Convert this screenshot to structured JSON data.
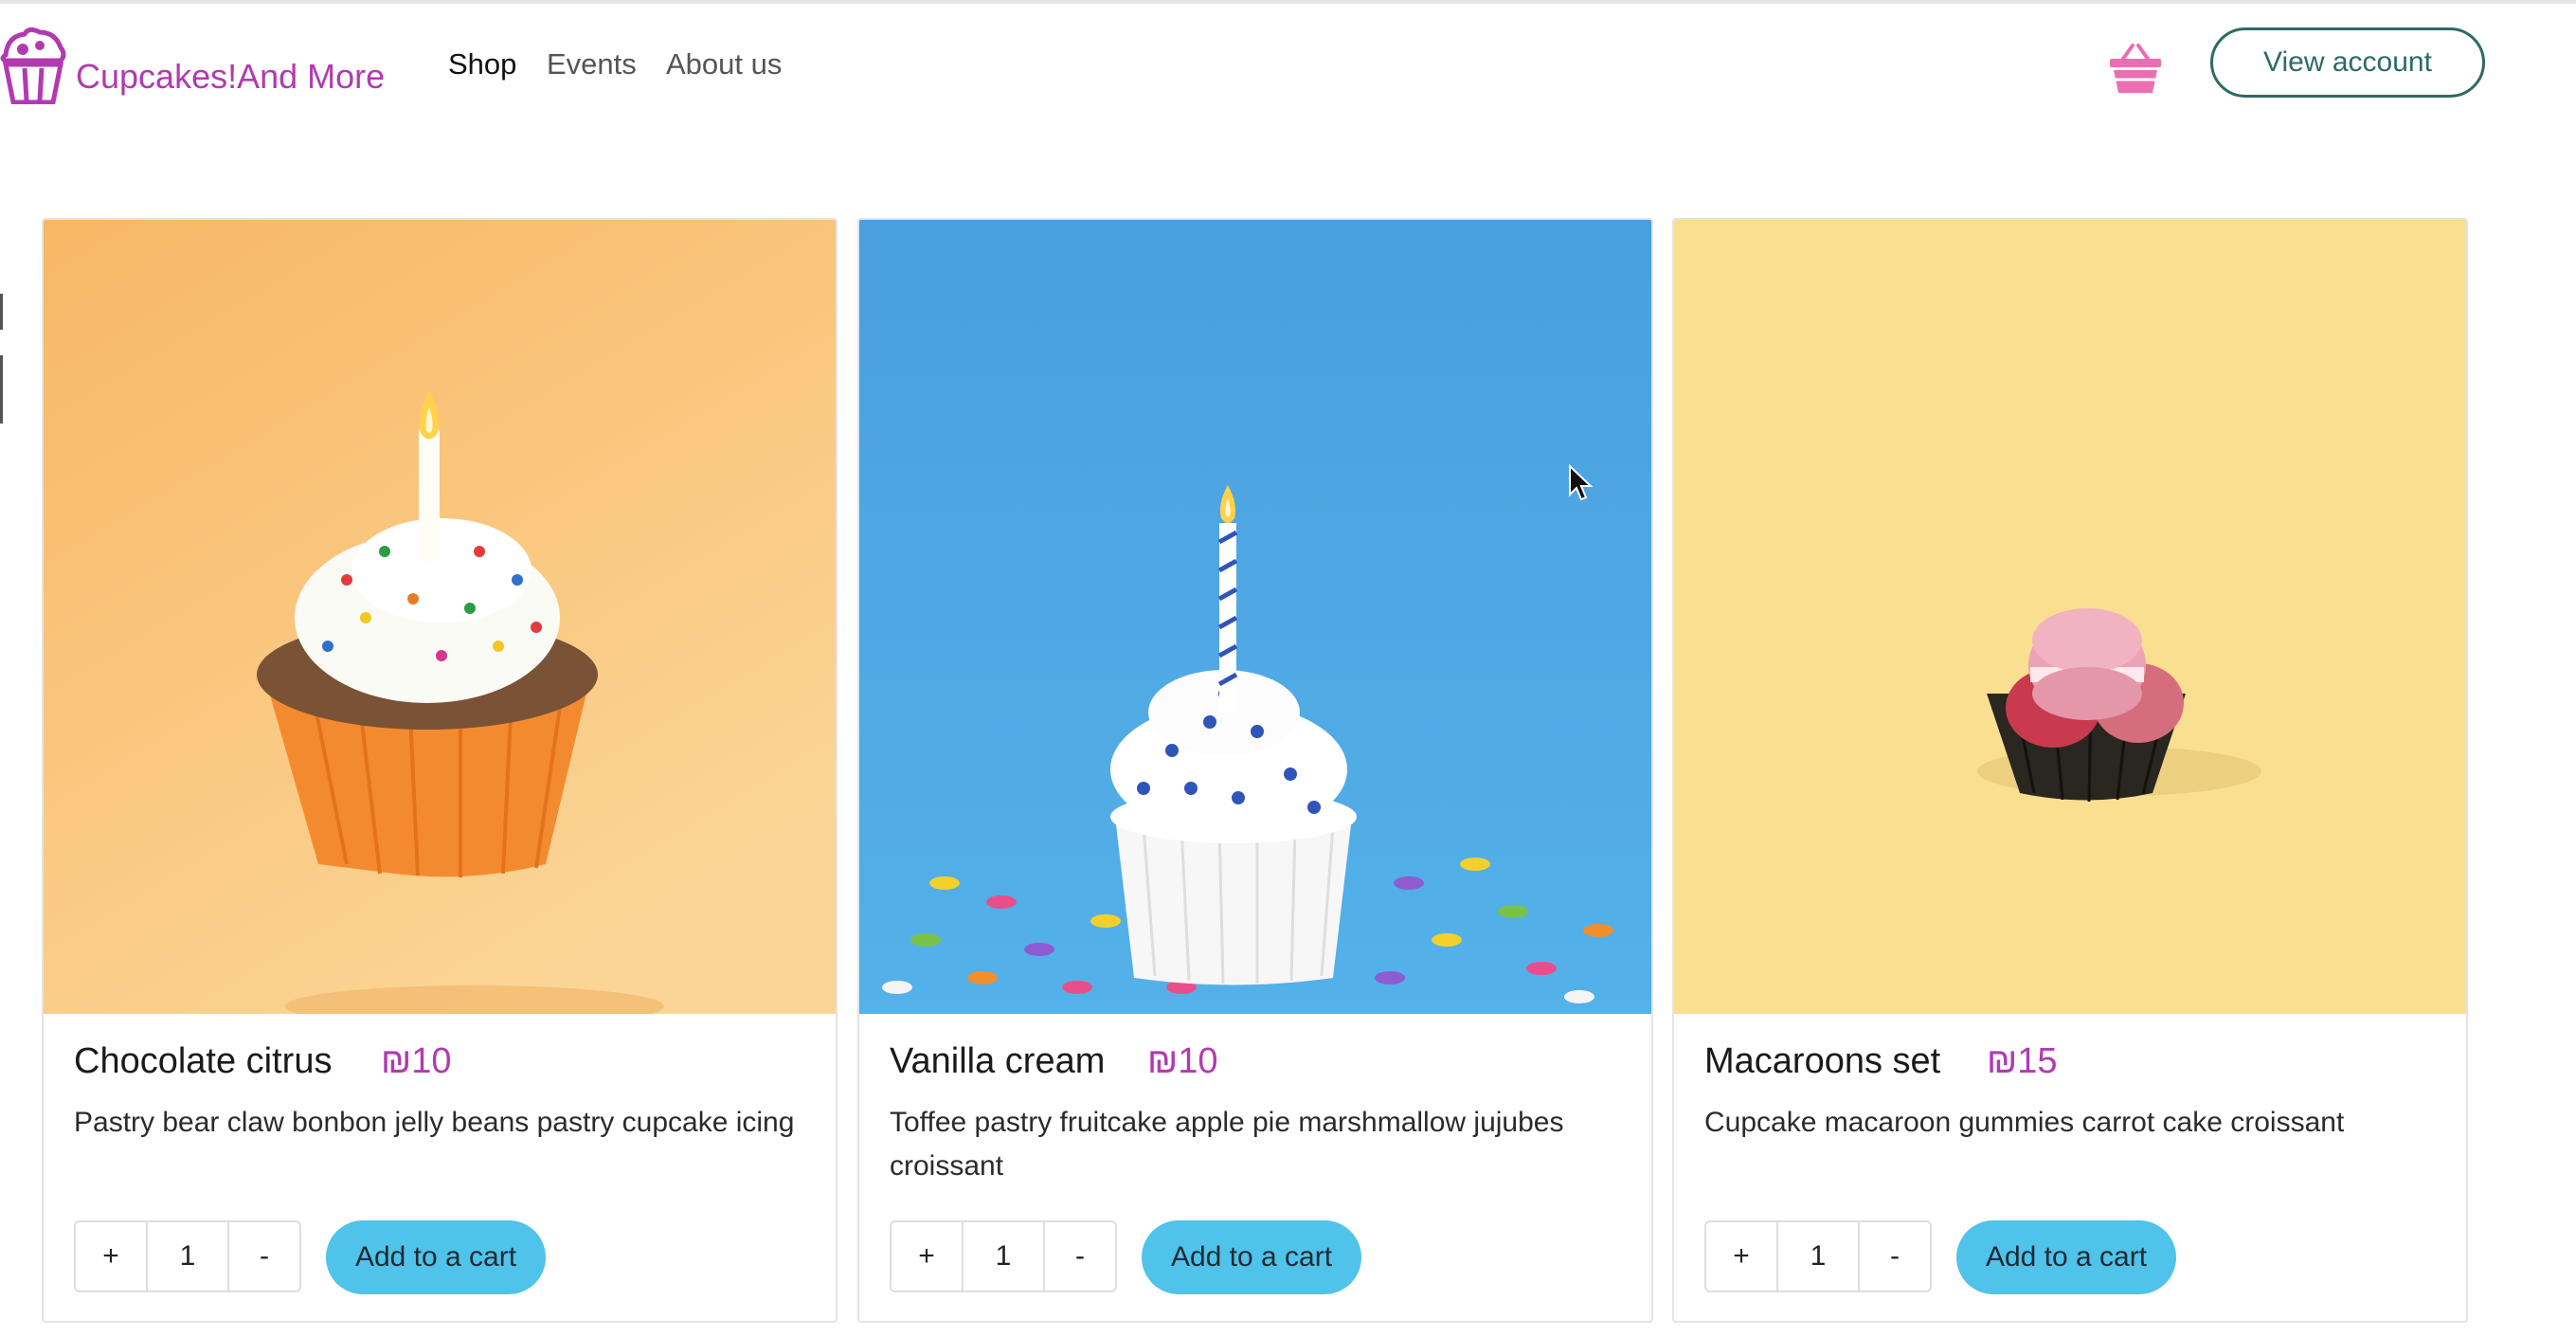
{
  "header": {
    "brand": "Cupcakes!And More",
    "nav": [
      {
        "label": "Shop",
        "active": true
      },
      {
        "label": "Events",
        "active": false
      },
      {
        "label": "About us",
        "active": false
      }
    ],
    "cart_icon": "basket-icon",
    "account_button": "View account"
  },
  "colors": {
    "brand": "#b23ab0",
    "accent_button": "#4fc3ea",
    "account_border": "#2d6b63",
    "card1_bg": "#f8b765",
    "card2_bg": "#4aa6e2",
    "card3_bg": "#f9df8f"
  },
  "products": [
    {
      "name": "Chocolate citrus",
      "price": "₪10",
      "description": "Pastry bear claw bonbon jelly beans pastry cupcake icing",
      "quantity": "1",
      "plus_label": "+",
      "minus_label": "-",
      "add_label": "Add to a cart",
      "image": "cupcake-with-candle-on-orange-background"
    },
    {
      "name": "Vanilla cream",
      "price": "₪10",
      "description": "Toffee pastry fruitcake apple pie marshmallow jujubes croissant",
      "quantity": "1",
      "plus_label": "+",
      "minus_label": "-",
      "add_label": "Add to a cart",
      "image": "vanilla-cupcake-with-candle-on-blue-background"
    },
    {
      "name": "Macaroons set",
      "price": "₪15",
      "description": "Cupcake macaroon gummies carrot cake croissant",
      "quantity": "1",
      "plus_label": "+",
      "minus_label": "-",
      "add_label": "Add to a cart",
      "image": "macarons-in-paper-cup-on-yellow-background"
    }
  ]
}
